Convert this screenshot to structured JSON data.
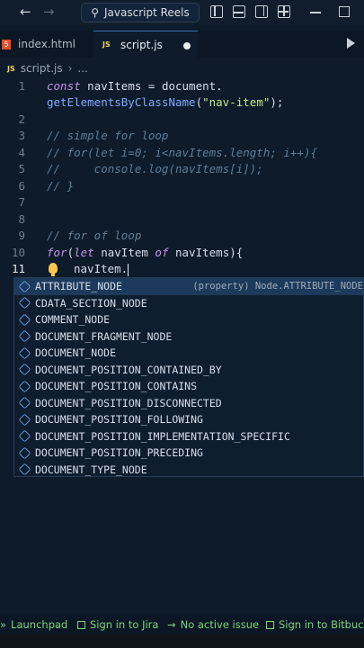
{
  "titlebar": {
    "search_text": "Javascript Reels",
    "back_glyph": "←",
    "forward_glyph": "→"
  },
  "tabs": [
    {
      "label": "index.html",
      "icon": "html5-icon",
      "active": false
    },
    {
      "label": "script.js",
      "icon": "js-file-icon",
      "active": true,
      "modified": true
    }
  ],
  "breadcrumb": {
    "file": "script.js",
    "rest": "..."
  },
  "editor": {
    "line_numbers": [
      "1",
      "2",
      "3",
      "4",
      "5",
      "6",
      "7",
      "8",
      "9",
      "10",
      "11"
    ],
    "lines": {
      "l1_kw": "const",
      "l1_rest": " navItems = document.",
      "l1b_fn": "getElementsByClassName",
      "l1b_open": "(",
      "l1b_str": "\"nav-item\"",
      "l1b_close": ");",
      "l3": "// simple for loop",
      "l4": "// for(let i=0; i<navItems.length; i++){",
      "l5": "//     console.log(navItems[i]);",
      "l6": "// }",
      "l9": "// for of loop",
      "l10_kw": "for",
      "l10_open": "(",
      "l10_let": "let",
      "l10_var": " navItem ",
      "l10_of": "of",
      "l10_rest": " navItems){",
      "l11": "navItem."
    }
  },
  "autocomplete": {
    "items": [
      "ATTRIBUTE_NODE",
      "CDATA_SECTION_NODE",
      "COMMENT_NODE",
      "DOCUMENT_FRAGMENT_NODE",
      "DOCUMENT_NODE",
      "DOCUMENT_POSITION_CONTAINED_BY",
      "DOCUMENT_POSITION_CONTAINS",
      "DOCUMENT_POSITION_DISCONNECTED",
      "DOCUMENT_POSITION_FOLLOWING",
      "DOCUMENT_POSITION_IMPLEMENTATION_SPECIFIC",
      "DOCUMENT_POSITION_PRECEDING",
      "DOCUMENT_TYPE_NODE"
    ],
    "selected_detail": "(property) Node.ATTRIBUTE_NODE"
  },
  "statusbar": {
    "launchpad": "Launchpad",
    "jira": "Sign in to Jira",
    "issue": "No active issue",
    "bitbucket": "Sign in to Bitbucke"
  },
  "colors": {
    "background": "#0d1b2a",
    "keyword": "#c792ea",
    "function": "#82aaff",
    "string": "#c3e88d",
    "comment": "#5f7e97",
    "status_green": "#7fd37a"
  }
}
